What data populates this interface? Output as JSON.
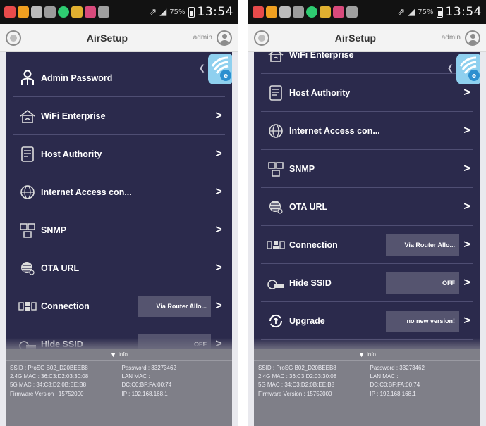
{
  "colors": {
    "content_bg": "#2b2a4c",
    "header_bg": "#f3f3f3",
    "info_bg": "#7f7f88",
    "value_box_bg": "#55546f",
    "statusbar_bg": "#121212"
  },
  "screens": [
    {
      "status_bar": {
        "battery": "75%",
        "time": "13:54"
      },
      "header": {
        "title": "AirSetup",
        "user": "admin"
      },
      "menu": [
        {
          "label": "Admin Password",
          "icon": "person-icon"
        },
        {
          "label": "WiFi Enterprise",
          "icon": "house-icon",
          "chevron": ">"
        },
        {
          "label": "Host Authority",
          "icon": "document-icon",
          "chevron": ">"
        },
        {
          "label": "Internet Access con...",
          "icon": "globe-icon",
          "chevron": ">"
        },
        {
          "label": "SNMP",
          "icon": "network-icon",
          "chevron": ">"
        },
        {
          "label": "OTA URL",
          "icon": "ota-globe-icon",
          "chevron": ">"
        },
        {
          "label": "Connection",
          "icon": "connection-icon",
          "value": "Via Router Allo...",
          "chevron": ">"
        },
        {
          "label": "Hide SSID",
          "icon": "hide-ssid-icon",
          "value": "OFF",
          "chevron": ">"
        }
      ],
      "info": {
        "title": "info",
        "ssid": "SSID : ProSG B02_D20BEEB8",
        "mac24": "2.4G MAC : 36:C3:D2:03:30:08",
        "mac5": "5G MAC : 34:C3:D2:0B:EE:B8",
        "firmware": "Firmware Version : 15752000",
        "password": "Password : 33273462",
        "lan_mac_label": "LAN MAC :",
        "lan_mac": "DC:C0:BF:FA:00:74",
        "ip": "IP : 192.168.168.1"
      }
    },
    {
      "status_bar": {
        "battery": "75%",
        "time": "13:54"
      },
      "header": {
        "title": "AirSetup",
        "user": "admin"
      },
      "menu": [
        {
          "label": "WiFi Enterprise",
          "icon": "house-icon"
        },
        {
          "label": "Host Authority",
          "icon": "document-icon",
          "chevron": ">"
        },
        {
          "label": "Internet Access con...",
          "icon": "globe-icon",
          "chevron": ">"
        },
        {
          "label": "SNMP",
          "icon": "network-icon",
          "chevron": ">"
        },
        {
          "label": "OTA URL",
          "icon": "ota-globe-icon",
          "chevron": ">"
        },
        {
          "label": "Connection",
          "icon": "connection-icon",
          "value": "Via Router Allo...",
          "chevron": ">"
        },
        {
          "label": "Hide SSID",
          "icon": "hide-ssid-icon",
          "value": "OFF",
          "chevron": ">"
        },
        {
          "label": "Upgrade",
          "icon": "upgrade-icon",
          "value": "no new version!",
          "chevron": ">"
        }
      ],
      "info": {
        "title": "info",
        "ssid": "SSID : ProSG B02_D20BEEB8",
        "mac24": "2.4G MAC : 36:C3:D2:03:30:08",
        "mac5": "5G MAC : 34:C3:D2:0B:EE:B8",
        "firmware": "Firmware Version : 15752000",
        "password": "Password : 33273462",
        "lan_mac_label": "LAN MAC :",
        "lan_mac": "DC:C0:BF:FA:00:74",
        "ip": "IP : 192.168.168.1"
      }
    }
  ]
}
